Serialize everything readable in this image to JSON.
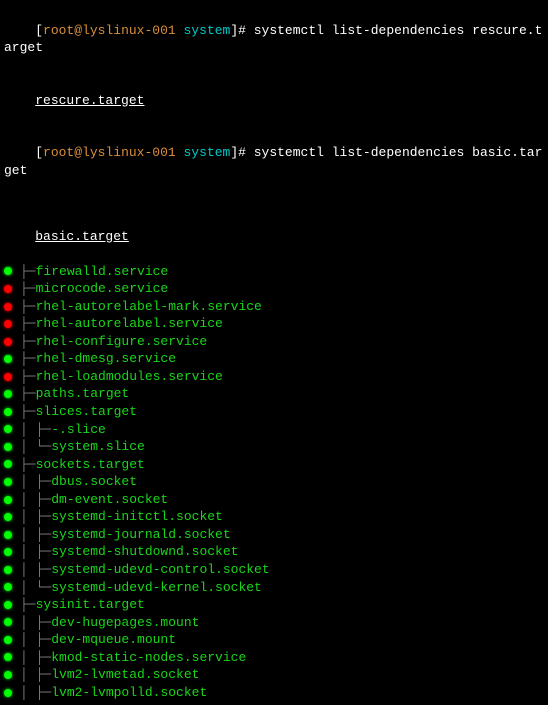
{
  "prompt1": {
    "user": "root",
    "host": "lyslinux-001",
    "path": "system",
    "cmd": "systemctl list-dependencies rescure.target"
  },
  "out1": "rescure.target",
  "prompt2": {
    "user": "root",
    "host": "lyslinux-001",
    "path": "system",
    "cmd": "systemctl list-dependencies basic.target"
  },
  "out2header": "basic.target",
  "tree": [
    {
      "bullet": "green",
      "prefix": "├─",
      "label": "firewalld.service"
    },
    {
      "bullet": "red",
      "prefix": "├─",
      "label": "microcode.service"
    },
    {
      "bullet": "red",
      "prefix": "├─",
      "label": "rhel-autorelabel-mark.service"
    },
    {
      "bullet": "red",
      "prefix": "├─",
      "label": "rhel-autorelabel.service"
    },
    {
      "bullet": "red",
      "prefix": "├─",
      "label": "rhel-configure.service"
    },
    {
      "bullet": "green",
      "prefix": "├─",
      "label": "rhel-dmesg.service"
    },
    {
      "bullet": "red",
      "prefix": "├─",
      "label": "rhel-loadmodules.service"
    },
    {
      "bullet": "green",
      "prefix": "├─",
      "label": "paths.target"
    },
    {
      "bullet": "green",
      "prefix": "├─",
      "label": "slices.target"
    },
    {
      "bullet": "green",
      "prefix": "│ ├─",
      "label": "-.slice"
    },
    {
      "bullet": "green",
      "prefix": "│ └─",
      "label": "system.slice"
    },
    {
      "bullet": "green",
      "prefix": "├─",
      "label": "sockets.target"
    },
    {
      "bullet": "green",
      "prefix": "│ ├─",
      "label": "dbus.socket"
    },
    {
      "bullet": "green",
      "prefix": "│ ├─",
      "label": "dm-event.socket"
    },
    {
      "bullet": "green",
      "prefix": "│ ├─",
      "label": "systemd-initctl.socket"
    },
    {
      "bullet": "green",
      "prefix": "│ ├─",
      "label": "systemd-journald.socket"
    },
    {
      "bullet": "green",
      "prefix": "│ ├─",
      "label": "systemd-shutdownd.socket"
    },
    {
      "bullet": "green",
      "prefix": "│ ├─",
      "label": "systemd-udevd-control.socket"
    },
    {
      "bullet": "green",
      "prefix": "│ └─",
      "label": "systemd-udevd-kernel.socket"
    },
    {
      "bullet": "green",
      "prefix": "├─",
      "label": "sysinit.target"
    },
    {
      "bullet": "green",
      "prefix": "│ ├─",
      "label": "dev-hugepages.mount"
    },
    {
      "bullet": "green",
      "prefix": "│ ├─",
      "label": "dev-mqueue.mount"
    },
    {
      "bullet": "green",
      "prefix": "│ ├─",
      "label": "kmod-static-nodes.service"
    },
    {
      "bullet": "green",
      "prefix": "│ ├─",
      "label": "lvm2-lvmetad.socket"
    },
    {
      "bullet": "green",
      "prefix": "│ ├─",
      "label": "lvm2-lvmpolld.socket"
    }
  ]
}
